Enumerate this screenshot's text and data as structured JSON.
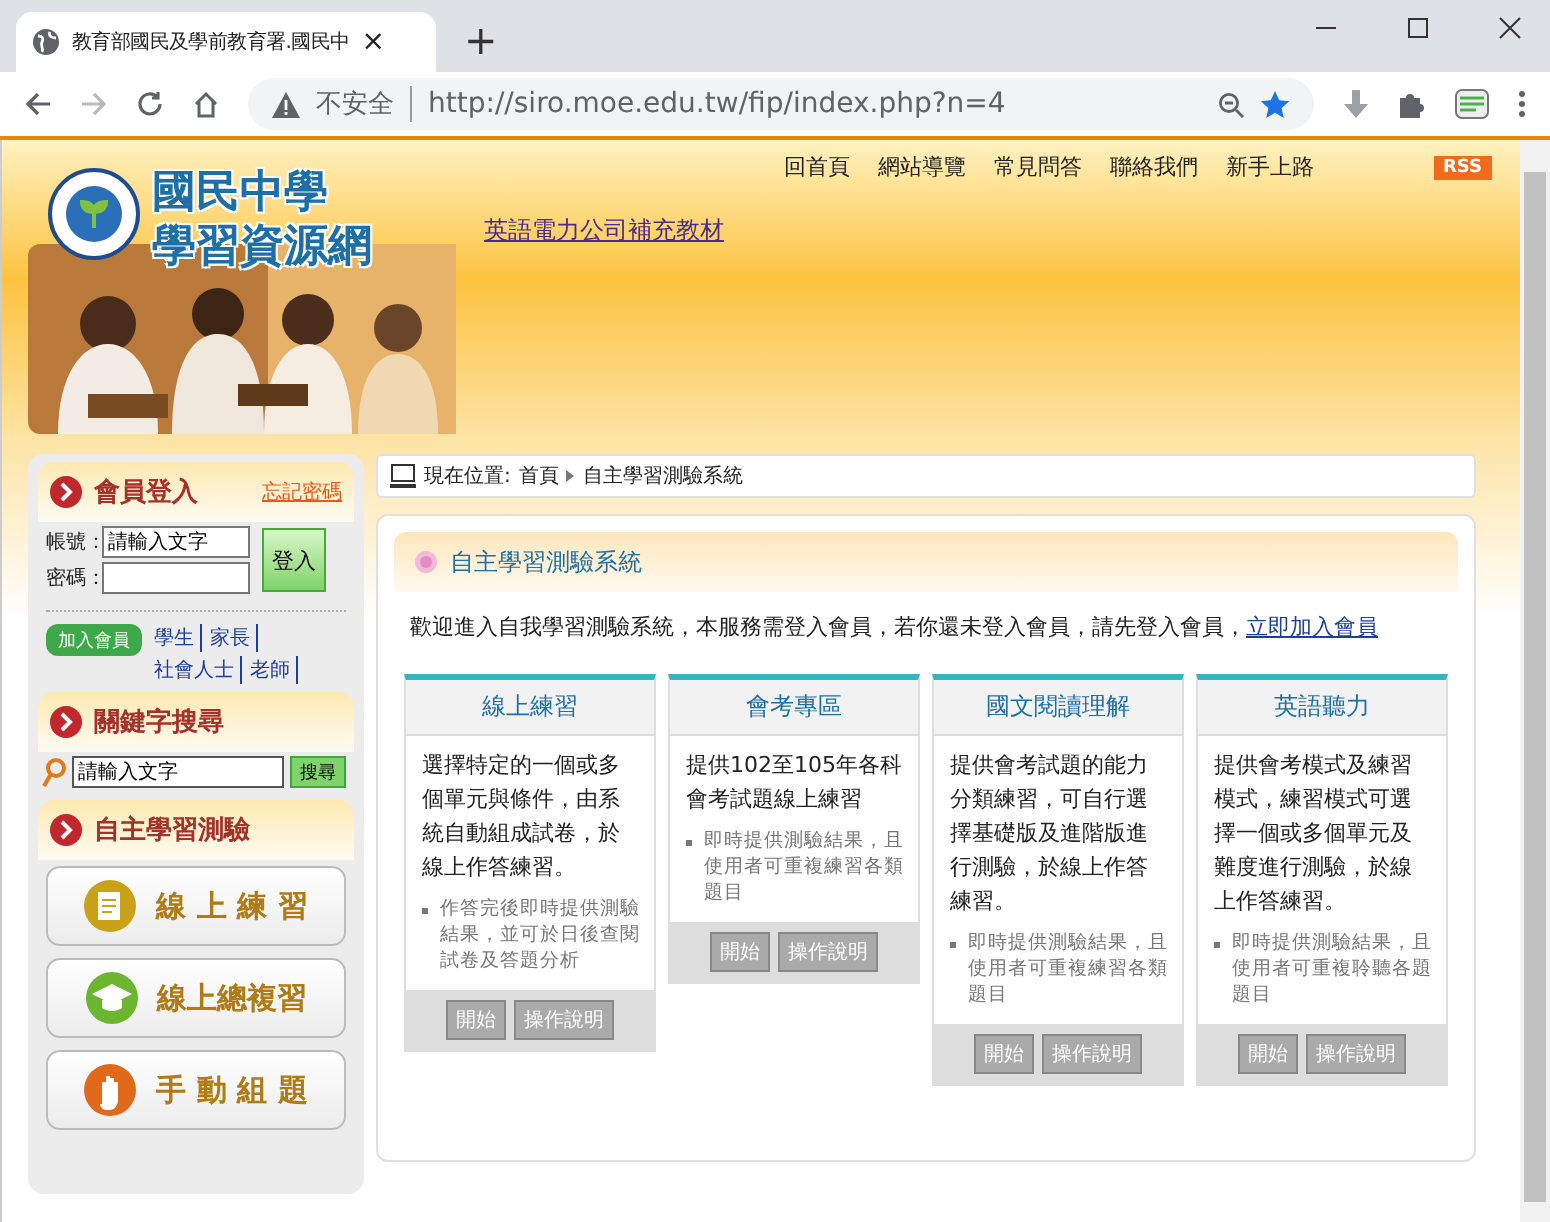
{
  "browser": {
    "tab_title": "教育部國民及學前教育署.國民中",
    "tab_close": "×",
    "new_tab": "+",
    "security": "不安全",
    "url": "http://siro.moe.edu.tw/fip/index.php?n=4"
  },
  "header": {
    "site_title": [
      "國民中學",
      "學習資源網"
    ],
    "top_links": [
      "回首頁",
      "網站導覽",
      "常見問答",
      "聯絡我們",
      "新手上路"
    ],
    "rss": "RSS",
    "promo_link": "英語電力公司補充教材"
  },
  "login": {
    "title": "會員登入",
    "forgot": "忘記密碼",
    "account_label": "帳號：",
    "account_value": "請輸入文字",
    "password_label": "密碼：",
    "submit": "登入",
    "join": "加入會員",
    "join_links": [
      "學生",
      "家長",
      "社會人士",
      "老師"
    ]
  },
  "search": {
    "title": "關鍵字搜尋",
    "value": "請輸入文字",
    "submit": "搜尋"
  },
  "self_test": {
    "title": "自主學習測驗",
    "buttons": [
      {
        "kind": "practice",
        "label": "線 上 練 習"
      },
      {
        "kind": "review",
        "label": "線上總複習"
      },
      {
        "kind": "manual",
        "label": "手 動 組 題"
      }
    ]
  },
  "breadcrumb": {
    "prefix": "現在位置:",
    "items": [
      "首頁",
      "自主學習測驗系統"
    ]
  },
  "section": {
    "title": "自主學習測驗系統",
    "intro": "歡迎進入自我學習測驗系統，本服務需登入會員，若你還未登入會員，請先登入會員，",
    "intro_link": "立即加入會員"
  },
  "cards": [
    {
      "title": "線上練習",
      "description": "選擇特定的一個或多個單元與條件，由系統自動組成試卷，於線上作答練習。",
      "bullet": "作答完後即時提供測驗結果，並可於日後查閱試卷及答題分析",
      "buttons": [
        "開始",
        "操作說明"
      ]
    },
    {
      "title": "會考專區",
      "description": "提供102至105年各科會考試題線上練習",
      "bullet": "即時提供測驗結果，且使用者可重複練習各類題目",
      "buttons": [
        "開始",
        "操作說明"
      ]
    },
    {
      "title": "國文閱讀理解",
      "description": "提供會考試題的能力分類練習，可自行選擇基礎版及進階版進行測驗，於線上作答練習。",
      "bullet": "即時提供測驗結果，且使用者可重複練習各類題目",
      "buttons": [
        "開始",
        "操作說明"
      ]
    },
    {
      "title": "英語聽力",
      "description": "提供會考模式及練習模式，練習模式可選擇一個或多個單元及難度進行測驗，於線上作答練習。",
      "bullet": "即時提供測驗結果，且使用者可重複聆聽各題題目",
      "buttons": [
        "開始",
        "操作說明"
      ]
    }
  ]
}
